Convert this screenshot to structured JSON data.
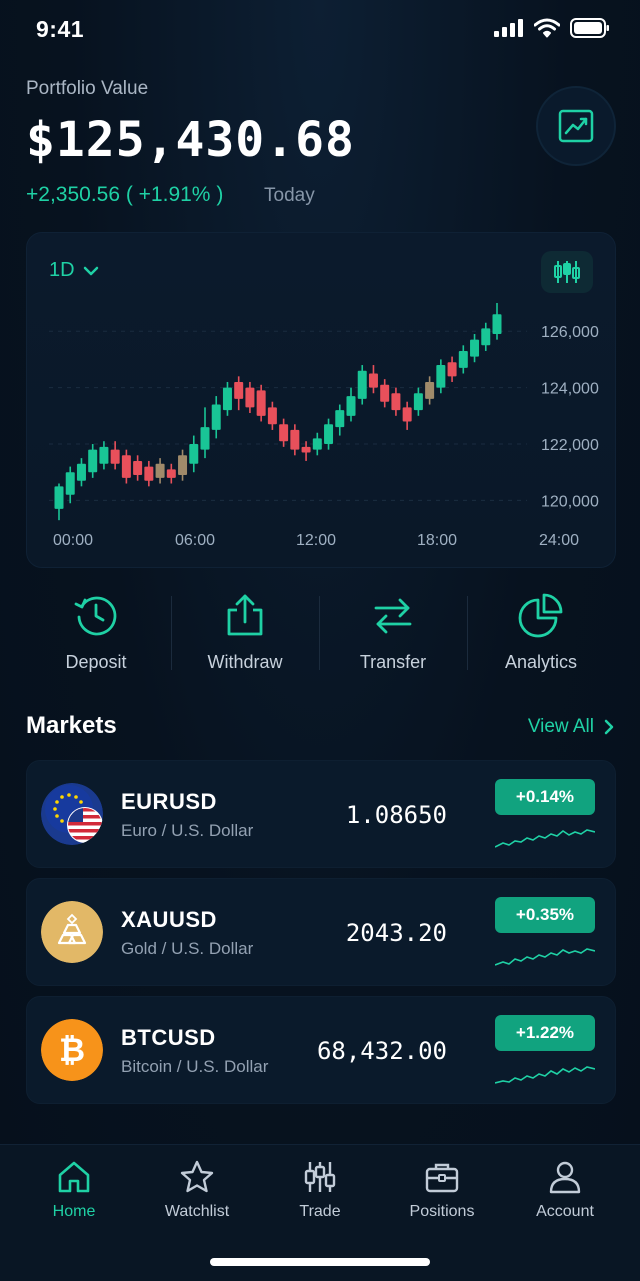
{
  "status_bar": {
    "time": "9:41"
  },
  "portfolio": {
    "label": "Portfolio Value",
    "value": "$125,430.68",
    "change": "+2,350.56 ( +1.91% )",
    "period": "Today"
  },
  "chart": {
    "timeframe": "1D",
    "y_ticks": [
      "126,000",
      "124,000",
      "122,000",
      "120,000"
    ],
    "x_ticks": [
      "00:00",
      "06:00",
      "12:00",
      "18:00",
      "24:00"
    ]
  },
  "chart_data": {
    "type": "candlestick",
    "ylim": [
      119200,
      127000
    ],
    "y_ticks": [
      126000,
      124000,
      122000,
      120000
    ],
    "x_ticks": [
      "00:00",
      "06:00",
      "12:00",
      "18:00",
      "24:00"
    ],
    "candles": [
      {
        "o": 119700,
        "c": 120500,
        "h": 120600,
        "l": 119300,
        "d": "up"
      },
      {
        "o": 120200,
        "c": 121000,
        "h": 121200,
        "l": 119900,
        "d": "up"
      },
      {
        "o": 120700,
        "c": 121300,
        "h": 121500,
        "l": 120500,
        "d": "up"
      },
      {
        "o": 121000,
        "c": 121800,
        "h": 122000,
        "l": 120800,
        "d": "up"
      },
      {
        "o": 121300,
        "c": 121900,
        "h": 122100,
        "l": 121100,
        "d": "up"
      },
      {
        "o": 121800,
        "c": 121300,
        "h": 122100,
        "l": 121100,
        "d": "down"
      },
      {
        "o": 121600,
        "c": 120800,
        "h": 121800,
        "l": 120600,
        "d": "down"
      },
      {
        "o": 121400,
        "c": 120900,
        "h": 121600,
        "l": 120700,
        "d": "down"
      },
      {
        "o": 121200,
        "c": 120700,
        "h": 121400,
        "l": 120500,
        "d": "down"
      },
      {
        "o": 120800,
        "c": 121300,
        "h": 121500,
        "l": 120600,
        "d": "neutral"
      },
      {
        "o": 121100,
        "c": 120800,
        "h": 121300,
        "l": 120600,
        "d": "down"
      },
      {
        "o": 120900,
        "c": 121600,
        "h": 121800,
        "l": 120700,
        "d": "neutral"
      },
      {
        "o": 121300,
        "c": 122000,
        "h": 122300,
        "l": 121000,
        "d": "up"
      },
      {
        "o": 121800,
        "c": 122600,
        "h": 123300,
        "l": 121500,
        "d": "up"
      },
      {
        "o": 122500,
        "c": 123400,
        "h": 123700,
        "l": 122200,
        "d": "up"
      },
      {
        "o": 123200,
        "c": 124000,
        "h": 124200,
        "l": 123000,
        "d": "up"
      },
      {
        "o": 124200,
        "c": 123600,
        "h": 124400,
        "l": 123200,
        "d": "down"
      },
      {
        "o": 124000,
        "c": 123300,
        "h": 124200,
        "l": 123100,
        "d": "down"
      },
      {
        "o": 123900,
        "c": 123000,
        "h": 124100,
        "l": 122800,
        "d": "down"
      },
      {
        "o": 123300,
        "c": 122700,
        "h": 123500,
        "l": 122500,
        "d": "down"
      },
      {
        "o": 122700,
        "c": 122100,
        "h": 122900,
        "l": 121900,
        "d": "down"
      },
      {
        "o": 122500,
        "c": 121800,
        "h": 122700,
        "l": 121600,
        "d": "down"
      },
      {
        "o": 121900,
        "c": 121700,
        "h": 122100,
        "l": 121400,
        "d": "down"
      },
      {
        "o": 121800,
        "c": 122200,
        "h": 122400,
        "l": 121600,
        "d": "up"
      },
      {
        "o": 122000,
        "c": 122700,
        "h": 122900,
        "l": 121800,
        "d": "up"
      },
      {
        "o": 122600,
        "c": 123200,
        "h": 123400,
        "l": 122300,
        "d": "up"
      },
      {
        "o": 123000,
        "c": 123700,
        "h": 124000,
        "l": 122800,
        "d": "up"
      },
      {
        "o": 123600,
        "c": 124600,
        "h": 124800,
        "l": 123400,
        "d": "up"
      },
      {
        "o": 124500,
        "c": 124000,
        "h": 124800,
        "l": 123800,
        "d": "down"
      },
      {
        "o": 124100,
        "c": 123500,
        "h": 124300,
        "l": 123300,
        "d": "down"
      },
      {
        "o": 123800,
        "c": 123200,
        "h": 124000,
        "l": 123000,
        "d": "down"
      },
      {
        "o": 123300,
        "c": 122800,
        "h": 123500,
        "l": 122500,
        "d": "down"
      },
      {
        "o": 123200,
        "c": 123800,
        "h": 124000,
        "l": 123000,
        "d": "up"
      },
      {
        "o": 123600,
        "c": 124200,
        "h": 124400,
        "l": 123400,
        "d": "neutral"
      },
      {
        "o": 124000,
        "c": 124800,
        "h": 125000,
        "l": 123800,
        "d": "up"
      },
      {
        "o": 124900,
        "c": 124400,
        "h": 125100,
        "l": 124200,
        "d": "down"
      },
      {
        "o": 124700,
        "c": 125300,
        "h": 125500,
        "l": 124500,
        "d": "up"
      },
      {
        "o": 125100,
        "c": 125700,
        "h": 125900,
        "l": 124900,
        "d": "up"
      },
      {
        "o": 125500,
        "c": 126100,
        "h": 126300,
        "l": 125300,
        "d": "up"
      },
      {
        "o": 125900,
        "c": 126600,
        "h": 127000,
        "l": 125700,
        "d": "up"
      }
    ]
  },
  "actions": [
    {
      "label": "Deposit",
      "icon": "clock-arrow-icon"
    },
    {
      "label": "Withdraw",
      "icon": "upload-icon"
    },
    {
      "label": "Transfer",
      "icon": "swap-arrows-icon"
    },
    {
      "label": "Analytics",
      "icon": "pie-chart-icon"
    }
  ],
  "markets": {
    "title": "Markets",
    "view_all": "View All",
    "items": [
      {
        "symbol": "EURUSD",
        "name": "Euro / U.S. Dollar",
        "price": "1.08650",
        "change": "+0.14%",
        "icon": "eu-us-flag-icon"
      },
      {
        "symbol": "XAUUSD",
        "name": "Gold / U.S. Dollar",
        "price": "2043.20",
        "change": "+0.35%",
        "icon": "gold-bar-icon"
      },
      {
        "symbol": "BTCUSD",
        "name": "Bitcoin / U.S. Dollar",
        "price": "68,432.00",
        "change": "+1.22%",
        "icon": "bitcoin-icon"
      }
    ]
  },
  "nav": [
    {
      "label": "Home",
      "icon": "home-icon",
      "active": true
    },
    {
      "label": "Watchlist",
      "icon": "star-icon",
      "active": false
    },
    {
      "label": "Trade",
      "icon": "sliders-icon",
      "active": false
    },
    {
      "label": "Positions",
      "icon": "briefcase-icon",
      "active": false
    },
    {
      "label": "Account",
      "icon": "user-icon",
      "active": false
    }
  ],
  "colors": {
    "accent": "#1fd1a5",
    "up": "#19c596",
    "down": "#e8505b",
    "neutral": "#a08a6a",
    "badge": "#11a37f",
    "background": "#07121f"
  }
}
